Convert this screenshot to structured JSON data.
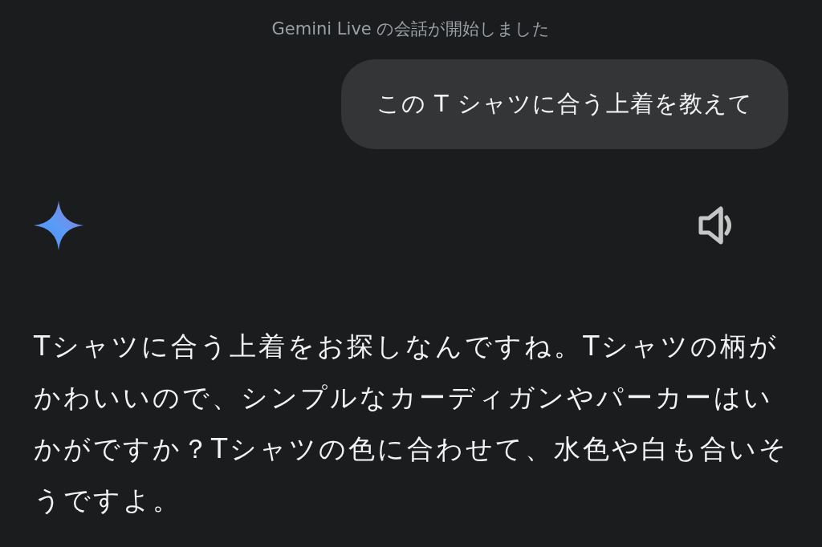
{
  "status_message": "Gemini Live の会話が開始しました",
  "user_message": "この T シャツに合う上着を教えて",
  "response": "Tシャツに合う上着をお探しなんですね。Tシャツの柄がかわいいので、シンプルなカーディガンやパーカーはいかがですか？Tシャツの色に合わせて、水色や白も合いそうですよ。"
}
